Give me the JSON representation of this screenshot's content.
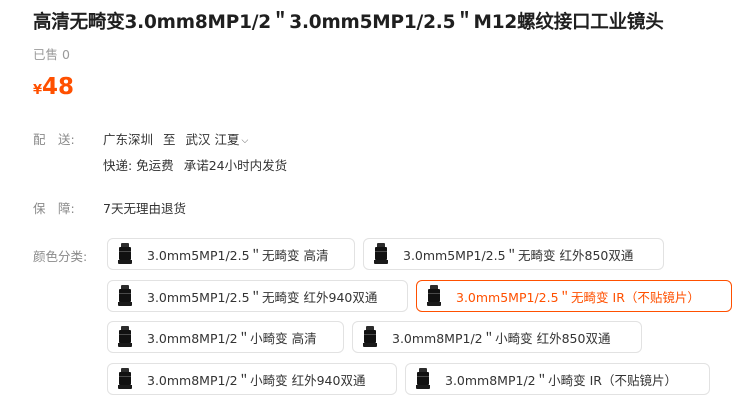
{
  "product": {
    "title": "高清无畸变3.0mm8MP1/2＂3.0mm5MP1/2.5＂M12螺纹接口工业镜头",
    "sold": "已售 0",
    "currency": "¥",
    "price": "48"
  },
  "shipping": {
    "label": "配　送:",
    "from": "广东深圳",
    "to_word": "至",
    "dest_city": "武汉",
    "dest_district": "江夏",
    "express": "快递: 免运费",
    "promise": "承诺24小时内发货"
  },
  "guarantee": {
    "label": "保　障:",
    "value": "7天无理由退货"
  },
  "colors": {
    "label": "颜色分类:",
    "selected_color": "#ff5000",
    "options": [
      {
        "label": "3.0mm5MP1/2.5＂无畸变 高清",
        "selected": false
      },
      {
        "label": "3.0mm5MP1/2.5＂无畸变 红外850双通",
        "selected": false
      },
      {
        "label": "3.0mm5MP1/2.5＂无畸变 红外940双通",
        "selected": false
      },
      {
        "label": "3.0mm5MP1/2.5＂无畸变 IR（不贴镜片）",
        "selected": true
      },
      {
        "label": "3.0mm8MP1/2＂小畸变 高清",
        "selected": false
      },
      {
        "label": "3.0mm8MP1/2＂小畸变 红外850双通",
        "selected": false
      },
      {
        "label": "3.0mm8MP1/2＂小畸变 红外940双通",
        "selected": false
      },
      {
        "label": "3.0mm8MP1/2＂小畸变 IR（不贴镜片）",
        "selected": false
      }
    ]
  }
}
